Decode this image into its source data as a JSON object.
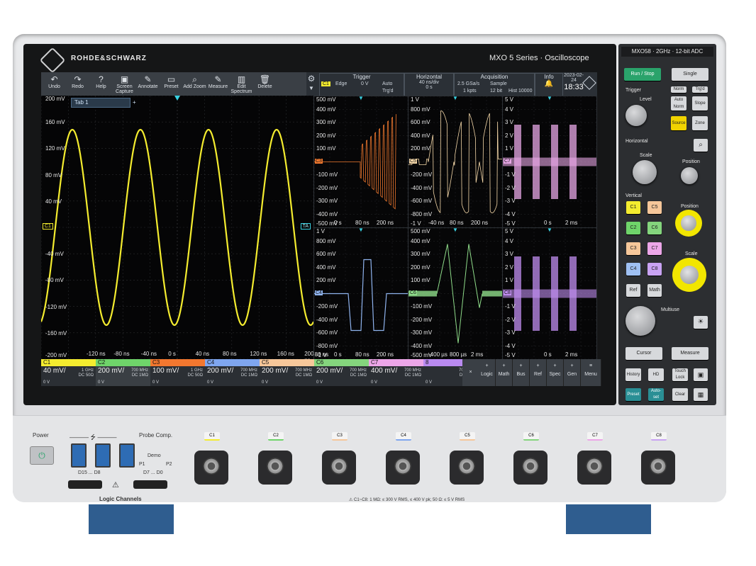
{
  "brand": {
    "name": "ROHDE&SCHWARZ",
    "series": "MXO 5 Series · Oscilloscope"
  },
  "toolbar": [
    {
      "label": "Undo",
      "icon": "undo-icon",
      "glyph": "↶"
    },
    {
      "label": "Redo",
      "icon": "redo-icon",
      "glyph": "↷"
    },
    {
      "label": "Help",
      "icon": "help-icon",
      "glyph": "?"
    },
    {
      "label": "Screen Capture",
      "icon": "camera-icon",
      "glyph": "▣"
    },
    {
      "label": "Annotate",
      "icon": "pen-icon",
      "glyph": "✎"
    },
    {
      "label": "Preset",
      "icon": "preset-icon",
      "glyph": "▭"
    },
    {
      "label": "Add Zoom",
      "icon": "zoom-icon",
      "glyph": "⌕"
    },
    {
      "label": "Measure",
      "icon": "ruler-icon",
      "glyph": "✎"
    },
    {
      "label": "Edit Spectrum",
      "icon": "spectrum-icon",
      "glyph": "▥"
    },
    {
      "label": "Delete",
      "icon": "trash-icon",
      "glyph": "🗑"
    }
  ],
  "header": {
    "trigger": {
      "title": "Trigger",
      "source": "C1",
      "type": "Edge",
      "level": "0 V",
      "mode": "Auto",
      "state": "Trg'd"
    },
    "horizontal": {
      "title": "Horizontal",
      "scale": "40 ns/div",
      "position": "0 s"
    },
    "acquisition": {
      "title": "Acquisition",
      "rate": "2.5 GSa/s",
      "mode": "Sample",
      "points": "1 kpts",
      "bits": "12 bit",
      "history": "Hist 10000"
    },
    "info": {
      "title": "Info"
    },
    "date": "2023-02-24",
    "time": "18:33"
  },
  "tab": {
    "label": "Tab 1",
    "add": "+"
  },
  "main_plot": {
    "y_labels": [
      "200 mV",
      "160 mV",
      "120 mV",
      "80 mV",
      "40 mV",
      "",
      "-40 mV",
      "-80 mV",
      "-120 mV",
      "-160 mV",
      "-200 mV"
    ],
    "x_labels": [
      "-120 ns",
      "-80 ns",
      "-40 ns",
      "0 s",
      "40 ns",
      "80 ns",
      "120 ns",
      "160 ns",
      "200 ns"
    ],
    "channel_marker": "C1",
    "trigger_marker": "TA"
  },
  "small_plots": [
    {
      "ch": "C3",
      "color": "#f0782e",
      "ylabels": [
        "500 mV",
        "400 mV",
        "300 mV",
        "200 mV",
        "100 mV",
        "",
        "-100 mV",
        "-200 mV",
        "-300 mV",
        "-400 mV",
        "-500 mV"
      ],
      "xlabels": [
        "0 s",
        "80 ns",
        "200 ns"
      ]
    },
    {
      "ch": "C5",
      "color": "#f4d7a8",
      "ylabels": [
        "1 V",
        "800 mV",
        "600 mV",
        "400 mV",
        "200 mV",
        "",
        "-200 mV",
        "-400 mV",
        "-600 mV",
        "-800 mV",
        "-1 V"
      ],
      "xlabels": [
        "-40 ns",
        "80 ns",
        "200 ns"
      ]
    },
    {
      "ch": "C7",
      "color": "#e7a7e6",
      "ylabels": [
        "5 V",
        "4 V",
        "3 V",
        "2 V",
        "1 V",
        "",
        "-1 V",
        "-2 V",
        "-3 V",
        "-4 V",
        "-5 V"
      ],
      "xlabels": [
        "0 s",
        "2 ms"
      ]
    },
    {
      "ch": "C4",
      "color": "#8fb3ee",
      "ylabels": [
        "1 V",
        "800 mV",
        "600 mV",
        "400 mV",
        "200 mV",
        "",
        "-200 mV",
        "-400 mV",
        "-600 mV",
        "-800 mV",
        "-1 V"
      ],
      "xlabels": [
        "-80 ns",
        "0 s",
        "80 ns",
        "200 ns"
      ]
    },
    {
      "ch": "C6",
      "color": "#8fdc8a",
      "ylabels": [
        "500 mV",
        "400 mV",
        "300 mV",
        "200 mV",
        "100 mV",
        "",
        "-100 mV",
        "-200 mV",
        "-300 mV",
        "-400 mV",
        "-500 mV"
      ],
      "xlabels": [
        "-400 µs",
        "800 µs",
        "2 ms"
      ]
    },
    {
      "ch": "C8",
      "color": "#c08ef0",
      "ylabels": [
        "5 V",
        "4 V",
        "3 V",
        "2 V",
        "1 V",
        "",
        "-1 V",
        "-2 V",
        "-3 V",
        "-4 V",
        "-5 V"
      ],
      "xlabels": [
        "0 s",
        "2 ms"
      ]
    }
  ],
  "channels": [
    {
      "tag": "C1",
      "color": "#f4ec2f",
      "scale": "40 mV/",
      "bw": "1 GHz",
      "coupling": "DC 50Ω",
      "offset": "0 V"
    },
    {
      "tag": "C2",
      "color": "#6fd46a",
      "scale": "200 mV/",
      "bw": "700 MHz",
      "coupling": "DC 1MΩ",
      "offset": "0 V"
    },
    {
      "tag": "C3",
      "color": "#f2772f",
      "scale": "100 mV/",
      "bw": "1 GHz",
      "coupling": "DC 50Ω",
      "offset": "0 V"
    },
    {
      "tag": "C4",
      "color": "#7fa6ef",
      "scale": "200 mV/",
      "bw": "700 MHz",
      "coupling": "DC 1MΩ",
      "offset": "0 V"
    },
    {
      "tag": "C5",
      "color": "#f6c79a",
      "scale": "200 mV/",
      "bw": "700 MHz",
      "coupling": "DC 1MΩ",
      "offset": "0 V"
    },
    {
      "tag": "C6",
      "color": "#84d57d",
      "scale": "200 mV/",
      "bw": "700 MHz",
      "coupling": "DC 1MΩ",
      "offset": "0 V"
    },
    {
      "tag": "C7",
      "color": "#eca6e8",
      "scale": "400 mV/",
      "bw": "700 MHz",
      "coupling": "DC 1MΩ",
      "offset": "0 V"
    },
    {
      "tag": "8",
      "color": "#b98af0",
      "scale": "",
      "bw": "700 MHz",
      "coupling": "DC 1MΩ",
      "offset": "0 V"
    }
  ],
  "bottom_buttons": [
    "Logic",
    "Math",
    "Bus",
    "Ref",
    "Spec",
    "Gen",
    "Menu"
  ],
  "panel": {
    "model": "MXO58  ·  2GHz  ·  12-bit ADC",
    "run_stop": "Run / Stop",
    "single": "Single",
    "trigger_title": "Trigger",
    "norm": "Norm",
    "trg": "Trg'd",
    "level": "Level",
    "auto_norm": "Auto Norm",
    "slope": "Slope",
    "source": "Source",
    "zone": "Zone",
    "horizontal_title": "Horizontal",
    "scale": "Scale",
    "position": "Position",
    "vertical_title": "Vertical",
    "ch_buttons": [
      "C1",
      "C5",
      "C2",
      "C6",
      "C3",
      "C7",
      "C4",
      "C8"
    ],
    "ref": "Ref",
    "math": "Math",
    "multiuse": "Multiuse",
    "cursor": "Cursor",
    "measure": "Measure",
    "history": "History",
    "hd": "HD",
    "touch_lock": "Touch Lock",
    "preset": "Preset",
    "autoset": "Auto-set",
    "clear": "Clear",
    "fine_coarse": "Fine Coarse"
  },
  "front": {
    "power": "Power",
    "probe_comp": "Probe Comp.",
    "demo": "Demo",
    "p1": "P1",
    "p2": "P2",
    "d15": "D15 ... D8",
    "d7": "D7 ... D0",
    "logic_channels": "Logic Channels",
    "inputs": [
      "C1",
      "C2",
      "C3",
      "C4",
      "C5",
      "C6",
      "C7",
      "C8"
    ],
    "warning": "C1~C8: 1 MΩ: ≤ 300 V RMS, ≤ 400 V pk; 50 Ω: ≤ 5 V RMS"
  }
}
